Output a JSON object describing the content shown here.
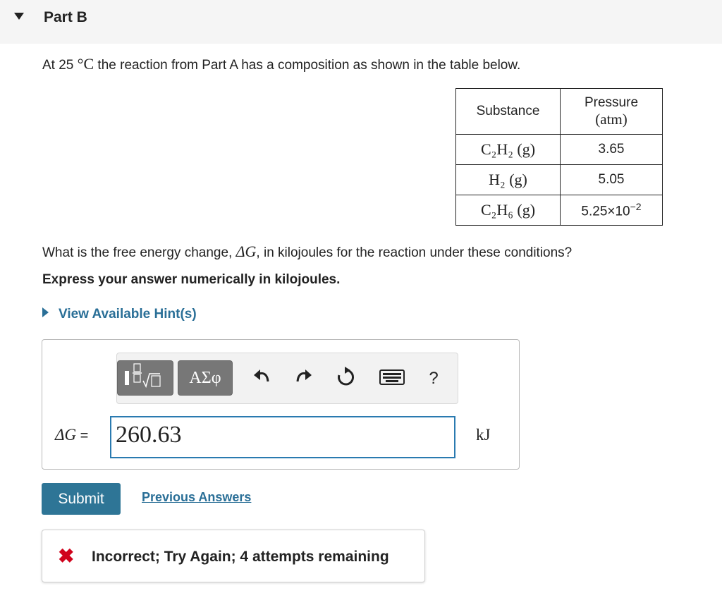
{
  "header": {
    "part_title": "Part B"
  },
  "intro": {
    "before": "At 25 ",
    "unit": "°C",
    "after": " the reaction from Part A has a composition as shown in the table below."
  },
  "table": {
    "col_substance": "Substance",
    "col_pressure_l1": "Pressure",
    "col_pressure_l2": "(atm)",
    "rows": [
      {
        "substance": "C₂H₂ (g)",
        "pressure": "3.65"
      },
      {
        "substance": "H₂ (g)",
        "pressure": "5.05"
      },
      {
        "substance": "C₂H₆ (g)",
        "pressure_base": "5.25×10",
        "pressure_exp": "−2"
      }
    ]
  },
  "question": {
    "before": "What is the free energy change, ",
    "symbol": "ΔG",
    "after": ", in kilojoules for the reaction under these conditions?"
  },
  "express": "Express your answer numerically in kilojoules.",
  "hint": "View Available Hint(s)",
  "toolbar": {
    "greek_label": "ΑΣφ",
    "help_label": "?",
    "icons": [
      "templates-icon",
      "undo-icon",
      "redo-icon",
      "reset-icon",
      "keyboard-icon",
      "help-icon"
    ]
  },
  "answer": {
    "label_symbol": "ΔG",
    "label_eq": " =",
    "value": "260.63",
    "unit": "kJ"
  },
  "buttons": {
    "submit": "Submit",
    "previous": "Previous Answers"
  },
  "feedback": {
    "icon": "✖",
    "text": "Incorrect; Try Again; 4 attempts remaining"
  },
  "colors": {
    "accent": "#2e7596",
    "link": "#2a6f97",
    "error": "#d0021b",
    "input_border": "#2a7ab0"
  }
}
